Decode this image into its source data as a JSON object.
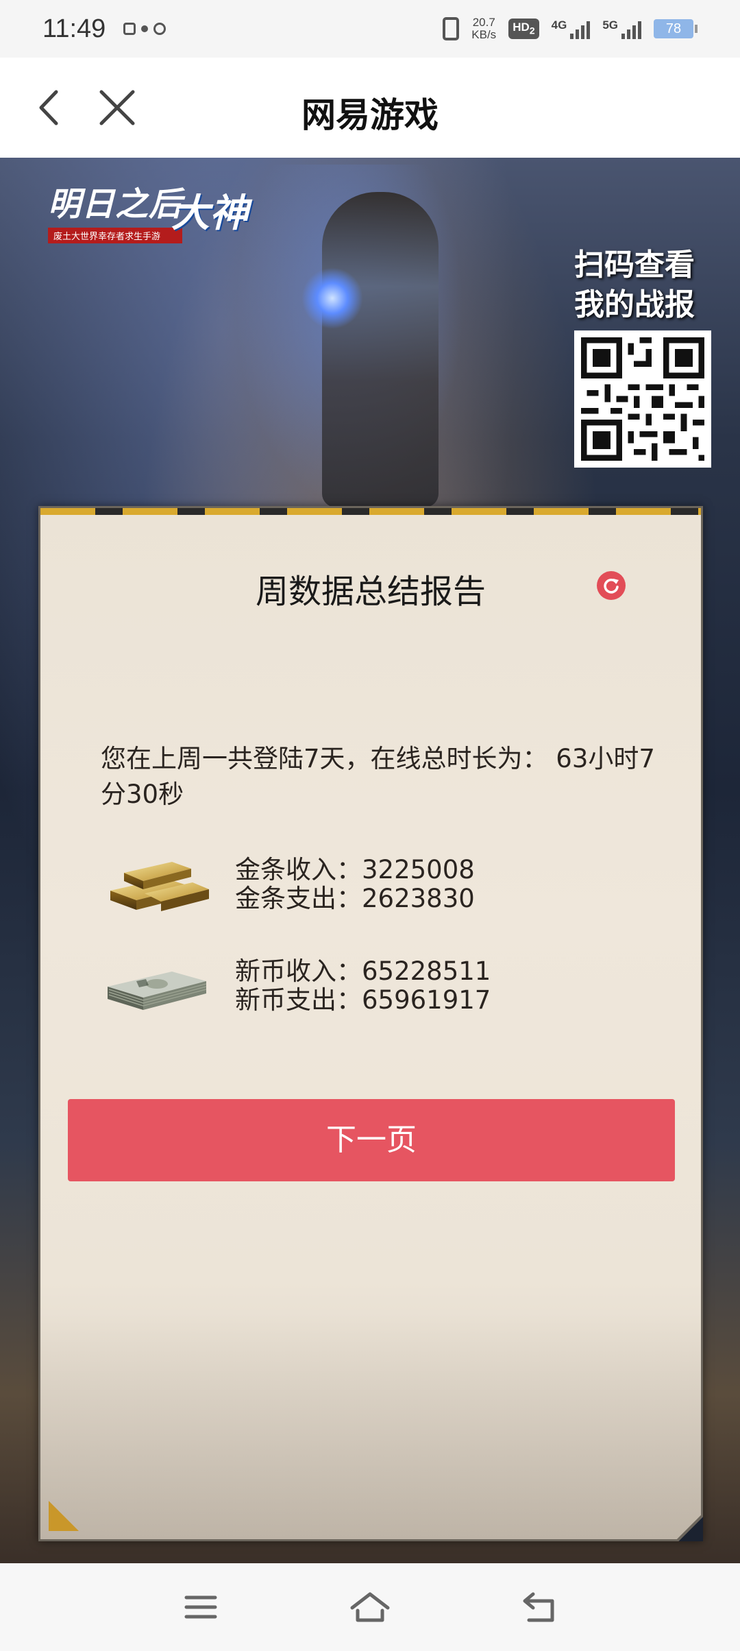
{
  "status_bar": {
    "time": "11:49",
    "net_speed_value": "20.7",
    "net_speed_unit": "KB/s",
    "hd_label": "HD",
    "hd_sub": "2",
    "signal1_label": "4G",
    "signal2_label": "5G",
    "battery": "78"
  },
  "title_bar": {
    "title": "网易游戏"
  },
  "banner": {
    "logo_main": "明日之后",
    "logo_sub": "废土大世界幸存者求生手游",
    "logo_dashen": "大神",
    "qr_caption_line1": "扫码查看",
    "qr_caption_line2": "我的战报"
  },
  "report": {
    "title": "周数据总结报告",
    "summary": "您在上周一共登陆7天，在线总时长为： 63小时7分30秒",
    "gold": {
      "income_label": "金条收入：",
      "income_value": "3225008",
      "expense_label": "金条支出：",
      "expense_value": "2623830"
    },
    "coin": {
      "income_label": "新币收入：",
      "income_value": "65228511",
      "expense_label": "新币支出：",
      "expense_value": "65961917"
    },
    "next_button": "下一页"
  },
  "colors": {
    "accent": "#e65561",
    "card_bg": "#ece4d7",
    "hazard_yellow": "#d9a92e"
  },
  "icons": {
    "back": "chevron-left-icon",
    "close": "close-icon",
    "refresh": "refresh-icon",
    "gold": "gold-bars-icon",
    "cash": "cash-stack-icon",
    "nav_menu": "menu-icon",
    "nav_home": "home-icon",
    "nav_back": "back-icon"
  }
}
